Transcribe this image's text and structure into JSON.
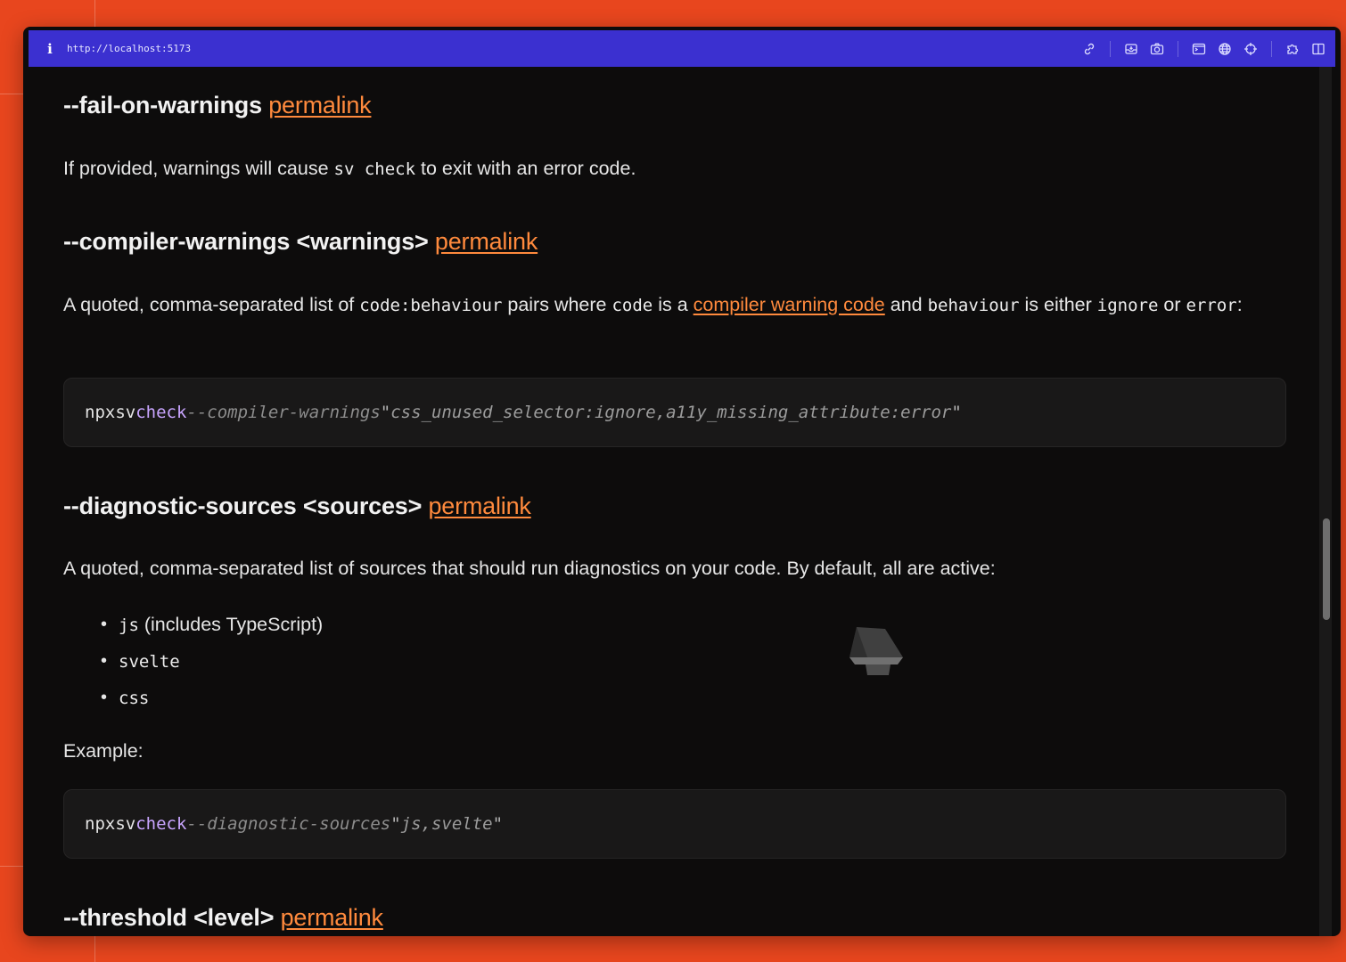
{
  "browser": {
    "url": "http://localhost:5173",
    "toolbar_icons": [
      "link-icon",
      "inbox-icon",
      "camera-icon",
      "terminal-icon",
      "globe-icon",
      "crosshair-icon",
      "puzzle-icon",
      "split-view-icon"
    ]
  },
  "sections": {
    "fail_on_warnings": {
      "heading": "--fail-on-warnings",
      "permalink": "permalink",
      "p_before": "If provided, warnings will cause ",
      "p_code": "sv check",
      "p_after": " to exit with an error code."
    },
    "compiler_warnings": {
      "heading": "--compiler-warnings <warnings>",
      "permalink": "permalink",
      "p1": "A quoted, comma-separated list of ",
      "c1": "code:behaviour",
      "p2": " pairs where ",
      "c2": "code",
      "p3": " is a ",
      "link": "compiler warning code",
      "p4": " and ",
      "c3": "behaviour",
      "p5": " is either ",
      "c4": "ignore",
      "p6": " or ",
      "c5": "error",
      "p7": ":",
      "code": {
        "npx": "npx",
        "sv": "sv",
        "check": "check",
        "flag": "--compiler-warnings",
        "q1": "\"",
        "str": "css_unused_selector:ignore,a11y_missing_attribute:error",
        "q2": "\""
      }
    },
    "diagnostic_sources": {
      "heading": "--diagnostic-sources <sources>",
      "permalink": "permalink",
      "p": "A quoted, comma-separated list of sources that should run diagnostics on your code. By default, all are active:",
      "items": [
        {
          "code": "js",
          "text": " (includes TypeScript)"
        },
        {
          "code": "svelte",
          "text": ""
        },
        {
          "code": "css",
          "text": ""
        }
      ],
      "example_label": "Example:",
      "code": {
        "npx": "npx",
        "sv": "sv",
        "check": "check",
        "flag": "--diagnostic-sources",
        "q1": "\"",
        "str": "js,svelte",
        "q2": "\""
      }
    },
    "threshold": {
      "heading": "--threshold <level>",
      "permalink": "permalink"
    }
  },
  "colors": {
    "accent": "#ff8a3d",
    "urlbar": "#3b30d0",
    "background": "#0d0c0c",
    "outer": "#e8461e"
  }
}
